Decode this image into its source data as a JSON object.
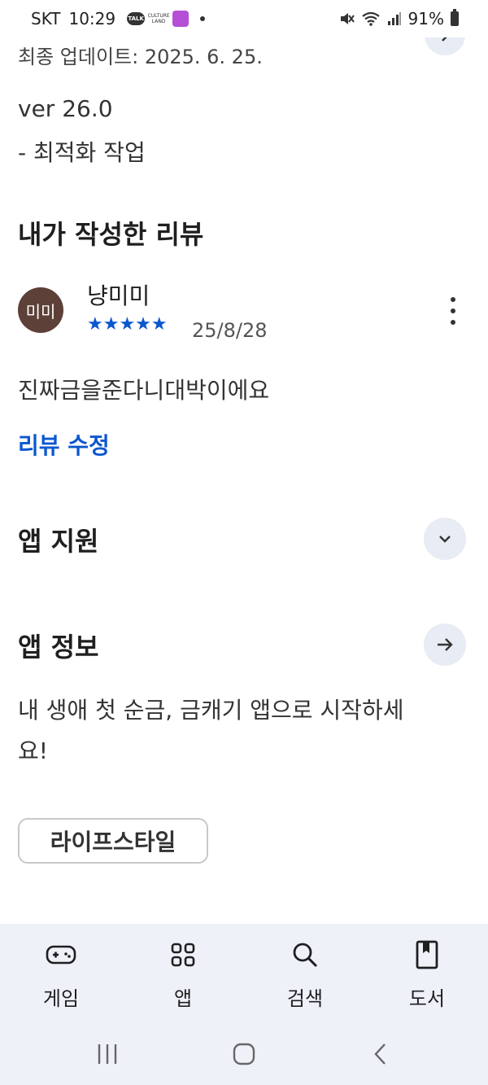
{
  "status_bar": {
    "carrier": "SKT",
    "time": "10:29",
    "talk_badge": "TALK",
    "culture_badge": "CULTURE LAND",
    "battery": "91%"
  },
  "app_update": {
    "last_updated": "최종 업데이트: 2025. 6. 25.",
    "version": "ver 26.0",
    "notes": "- 최적화 작업"
  },
  "my_review": {
    "title": "내가 작성한 리뷰",
    "avatar_text": "미미",
    "avatar_color": "#5d4037",
    "reviewer": "냥미미",
    "rating": 5,
    "stars": "★★★★★",
    "date": "25/8/28",
    "text": "진짜금을준다니대박이에요",
    "edit_label": "리뷰 수정"
  },
  "app_support": {
    "title": "앱 지원"
  },
  "app_info": {
    "title": "앱 정보",
    "description": "내 생애 첫 순금, 금캐기 앱으로 시작하세요!",
    "category": "라이프스타일"
  },
  "bottom_nav": {
    "items": [
      {
        "label": "게임",
        "icon": "gamepad-icon"
      },
      {
        "label": "앱",
        "icon": "apps-grid-icon"
      },
      {
        "label": "검색",
        "icon": "search-icon"
      },
      {
        "label": "도서",
        "icon": "book-icon"
      }
    ]
  },
  "colors": {
    "accent": "#0b57d0",
    "button_bg": "#e8ecf4",
    "nav_bg": "#eef1f8"
  }
}
